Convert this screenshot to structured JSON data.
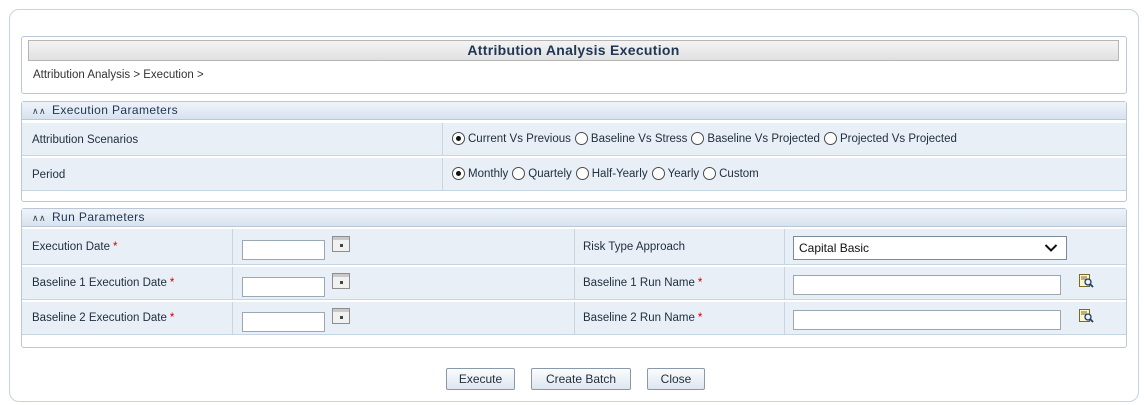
{
  "page": {
    "title": "Attribution Analysis Execution",
    "breadcrumb": "Attribution Analysis > Execution >"
  },
  "execution_parameters": {
    "header": "Execution Parameters",
    "attribution_scenarios": {
      "label": "Attribution Scenarios",
      "options": [
        "Current Vs Previous",
        "Baseline Vs Stress",
        "Baseline Vs Projected",
        "Projected Vs Projected"
      ],
      "selected": "Current Vs Previous"
    },
    "period": {
      "label": "Period",
      "options": [
        "Monthly",
        "Quartely",
        "Half-Yearly",
        "Yearly",
        "Custom"
      ],
      "selected": "Monthly"
    }
  },
  "run_parameters": {
    "header": "Run Parameters",
    "execution_date": {
      "label": "Execution Date",
      "value": ""
    },
    "baseline1_execution_date": {
      "label": "Baseline 1 Execution Date",
      "value": ""
    },
    "baseline2_execution_date": {
      "label": "Baseline 2 Execution Date",
      "value": ""
    },
    "risk_type_approach": {
      "label": "Risk Type Approach",
      "value": "Capital Basic"
    },
    "baseline1_run_name": {
      "label": "Baseline 1 Run Name",
      "value": ""
    },
    "baseline2_run_name": {
      "label": "Baseline 2 Run Name",
      "value": ""
    },
    "required_marker": "*"
  },
  "buttons": {
    "execute": "Execute",
    "create_batch": "Create Batch",
    "close": "Close"
  },
  "icons": {
    "section_toggle": "chevron-up-double-icon",
    "calendar": "calendar-icon",
    "lookup": "lookup-icon",
    "dropdown": "chevron-down-icon"
  },
  "colors": {
    "row_bg": "#e8eff7",
    "section_header_bg": "#d8e3ef",
    "required": "#d40000",
    "title_text": "#1f3552"
  }
}
